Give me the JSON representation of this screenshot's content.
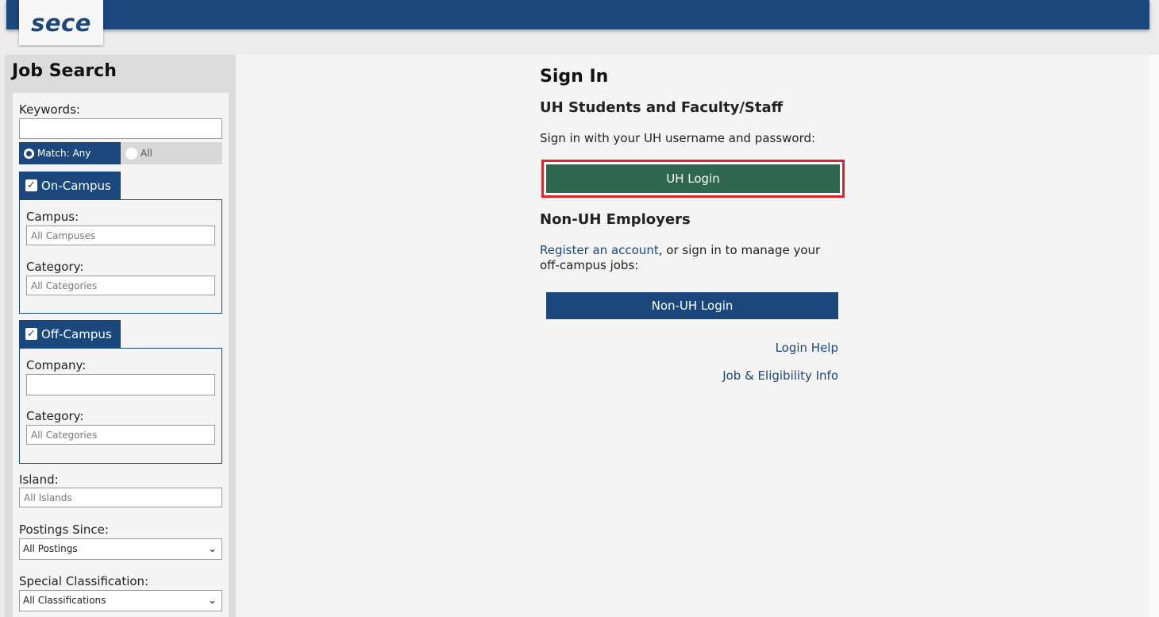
{
  "header": {
    "logo_text": "sece"
  },
  "sidebar": {
    "title": "Job Search",
    "keywords_label": "Keywords:",
    "keywords_value": "",
    "match_any_label": "Match: Any",
    "match_all_label": "All",
    "on_campus": {
      "tab_label": "On-Campus",
      "checked": true,
      "campus_label": "Campus:",
      "campus_placeholder": "All Campuses",
      "category_label": "Category:",
      "category_placeholder": "All Categories"
    },
    "off_campus": {
      "tab_label": "Off-Campus",
      "checked": true,
      "company_label": "Company:",
      "company_value": "",
      "category_label": "Category:",
      "category_placeholder": "All Categories"
    },
    "island_label": "Island:",
    "island_placeholder": "All Islands",
    "postings_label": "Postings Since:",
    "postings_value": "All Postings",
    "classification_label": "Special Classification:",
    "classification_value": "All Classifications"
  },
  "main": {
    "title": "Sign In",
    "uh_heading": "UH Students and Faculty/Staff",
    "uh_instructions": "Sign in with your UH username and password:",
    "uh_login_label": "UH Login",
    "nonuh_heading": "Non-UH Employers",
    "register_link": "Register an account",
    "nonuh_text": ", or sign in to manage your off-campus jobs:",
    "nonuh_login_label": "Non-UH Login",
    "login_help": "Login Help",
    "job_info": "Job & Eligibility Info"
  },
  "colors": {
    "brand_blue": "#1b477d",
    "uh_green": "#2e6650",
    "highlight_red": "#d8262b"
  }
}
